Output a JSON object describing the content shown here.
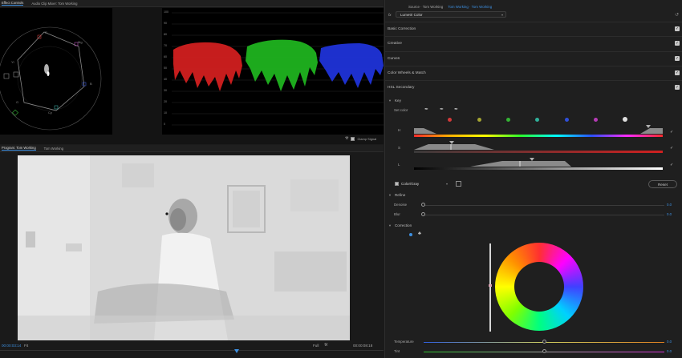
{
  "scopes": {
    "tabs": [
      "Effect Controls",
      "Audio Clip Mixer: Tom Working"
    ],
    "vectorscope_labels": [
      "R",
      "Mg",
      "B",
      "Cy",
      "G",
      "Yl"
    ],
    "parade_ticks": [
      "100",
      "90",
      "80",
      "70",
      "60",
      "50",
      "40",
      "30",
      "20",
      "10",
      "0"
    ],
    "clamp_signal_label": "Clamp Signal"
  },
  "program": {
    "tabs": [
      "Program: Tom Working",
      "Tom Working"
    ],
    "timecode_left": "00:00:03:14",
    "fit_label": "Fit",
    "full_label": "Full",
    "timecode_right": "00:00:08:18"
  },
  "lumetri": {
    "tab_source": "Source · Tom Working",
    "tab_clip": "Tom Working · Tom Working",
    "fx_label": "fx",
    "effect_name": "Lumetri Color",
    "sections": [
      "Basic Correction",
      "Creative",
      "Curves",
      "Color Wheels & Match",
      "HSL Secondary"
    ],
    "key": {
      "header": "Key",
      "set_color_label": "Set color",
      "hsl_labels": [
        "H",
        "S",
        "L"
      ],
      "swatch_colors": [
        "#d23a3a",
        "#a5a532",
        "#34b334",
        "#30b09a",
        "#2f4fd9",
        "#b53bb5",
        "#e0e0e0"
      ],
      "color_gray_label": "Color/Gray",
      "reset_label": "Reset"
    },
    "refine": {
      "header": "Refine",
      "denoise_label": "Denoise",
      "denoise_value": "0.0",
      "blur_label": "Blur",
      "blur_value": "0.0"
    },
    "correction": {
      "header": "Correction",
      "temperature_label": "Temperature",
      "temperature_value": "0.0",
      "tint_label": "Tint",
      "tint_value": "0.0"
    }
  }
}
